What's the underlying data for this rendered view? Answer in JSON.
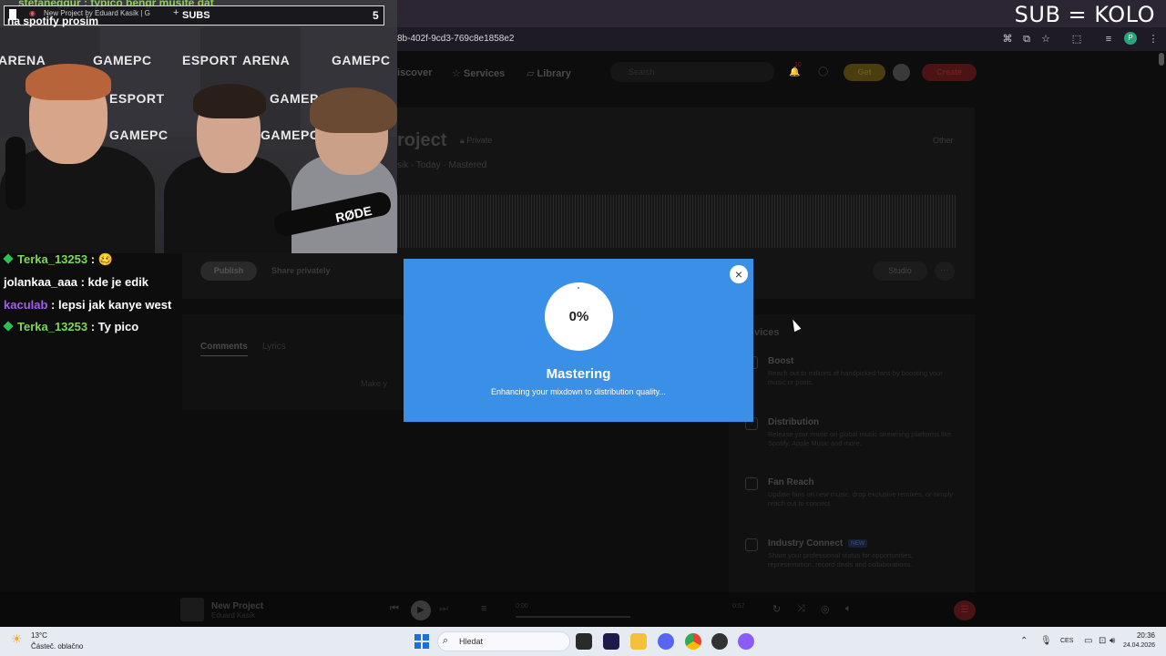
{
  "overlay": {
    "text": "SUB = KOLO"
  },
  "browser": {
    "url": "8b-402f-9cd3-769c8e1858e2",
    "profile_initial": "P"
  },
  "nav": {
    "discover": "iscover",
    "services": "Services",
    "library": "Library",
    "search_placeholder": "Search",
    "notif_count": "10",
    "get_label": "Get",
    "create_label": "Create"
  },
  "project": {
    "title": "roject",
    "privacy": "Private",
    "subtitle": "sik · Today · Mastered",
    "other": "Other",
    "publish": "Publish",
    "share": "Share privately",
    "studio": "Studio"
  },
  "tabs": {
    "comments": "Comments",
    "lyrics": "Lyrics",
    "hint": "Make y"
  },
  "services": {
    "title": "vices",
    "items": [
      {
        "title": "Boost",
        "desc": "Reach out to millions of handpicked fans by boosting your music or posts."
      },
      {
        "title": "Distribution",
        "desc": "Release your music on global music streaming platforms like Spotify, Apple Music and more."
      },
      {
        "title": "Fan Reach",
        "desc": "Update fans on new music, drop exclusive remixes, or simply reach out to connect."
      },
      {
        "title": "Industry Connect",
        "desc": "Share your professional status for opportunities, representation, record deals and collaborations."
      }
    ],
    "new_badge": "NEW"
  },
  "player": {
    "title": "New Project",
    "artist": "Eduard Kasík",
    "time_current": "0:00",
    "time_end": "0:57"
  },
  "webcam": {
    "tab_title": "New Project by Eduard Kasík | G",
    "subs_label": "SUBS",
    "subs_count": "5",
    "chat_top1": "stefaneggur : typico bengr musite dat",
    "chat_top2": "na spotify prosim",
    "banner_row1": [
      "ARENA",
      "GAMEPC",
      "ESPORT",
      "ARENA",
      "GAMEPC"
    ],
    "rode": "RØDE"
  },
  "chat": [
    {
      "name": "Terka_13253",
      "msg": ": 🥴",
      "badge": true,
      "color": "green"
    },
    {
      "name": "jolankaa_aaa",
      "msg": ": kde je edik",
      "badge": false,
      "color": "white"
    },
    {
      "name": "kaculab",
      "msg": ": lepsi jak kanye west",
      "badge": false,
      "color": "purple"
    },
    {
      "name": "Terka_13253",
      "msg": ": Ty pico",
      "badge": true,
      "color": "green"
    }
  ],
  "modal": {
    "progress": "0%",
    "title": "Mastering",
    "subtitle": "Enhancing your mixdown to distribution quality..."
  },
  "taskbar": {
    "temp": "13°C",
    "weather": "Částeč. oblačno",
    "search_placeholder": "Hledat",
    "lang": "CES",
    "time": "20:36",
    "date": "24.04.2026"
  }
}
